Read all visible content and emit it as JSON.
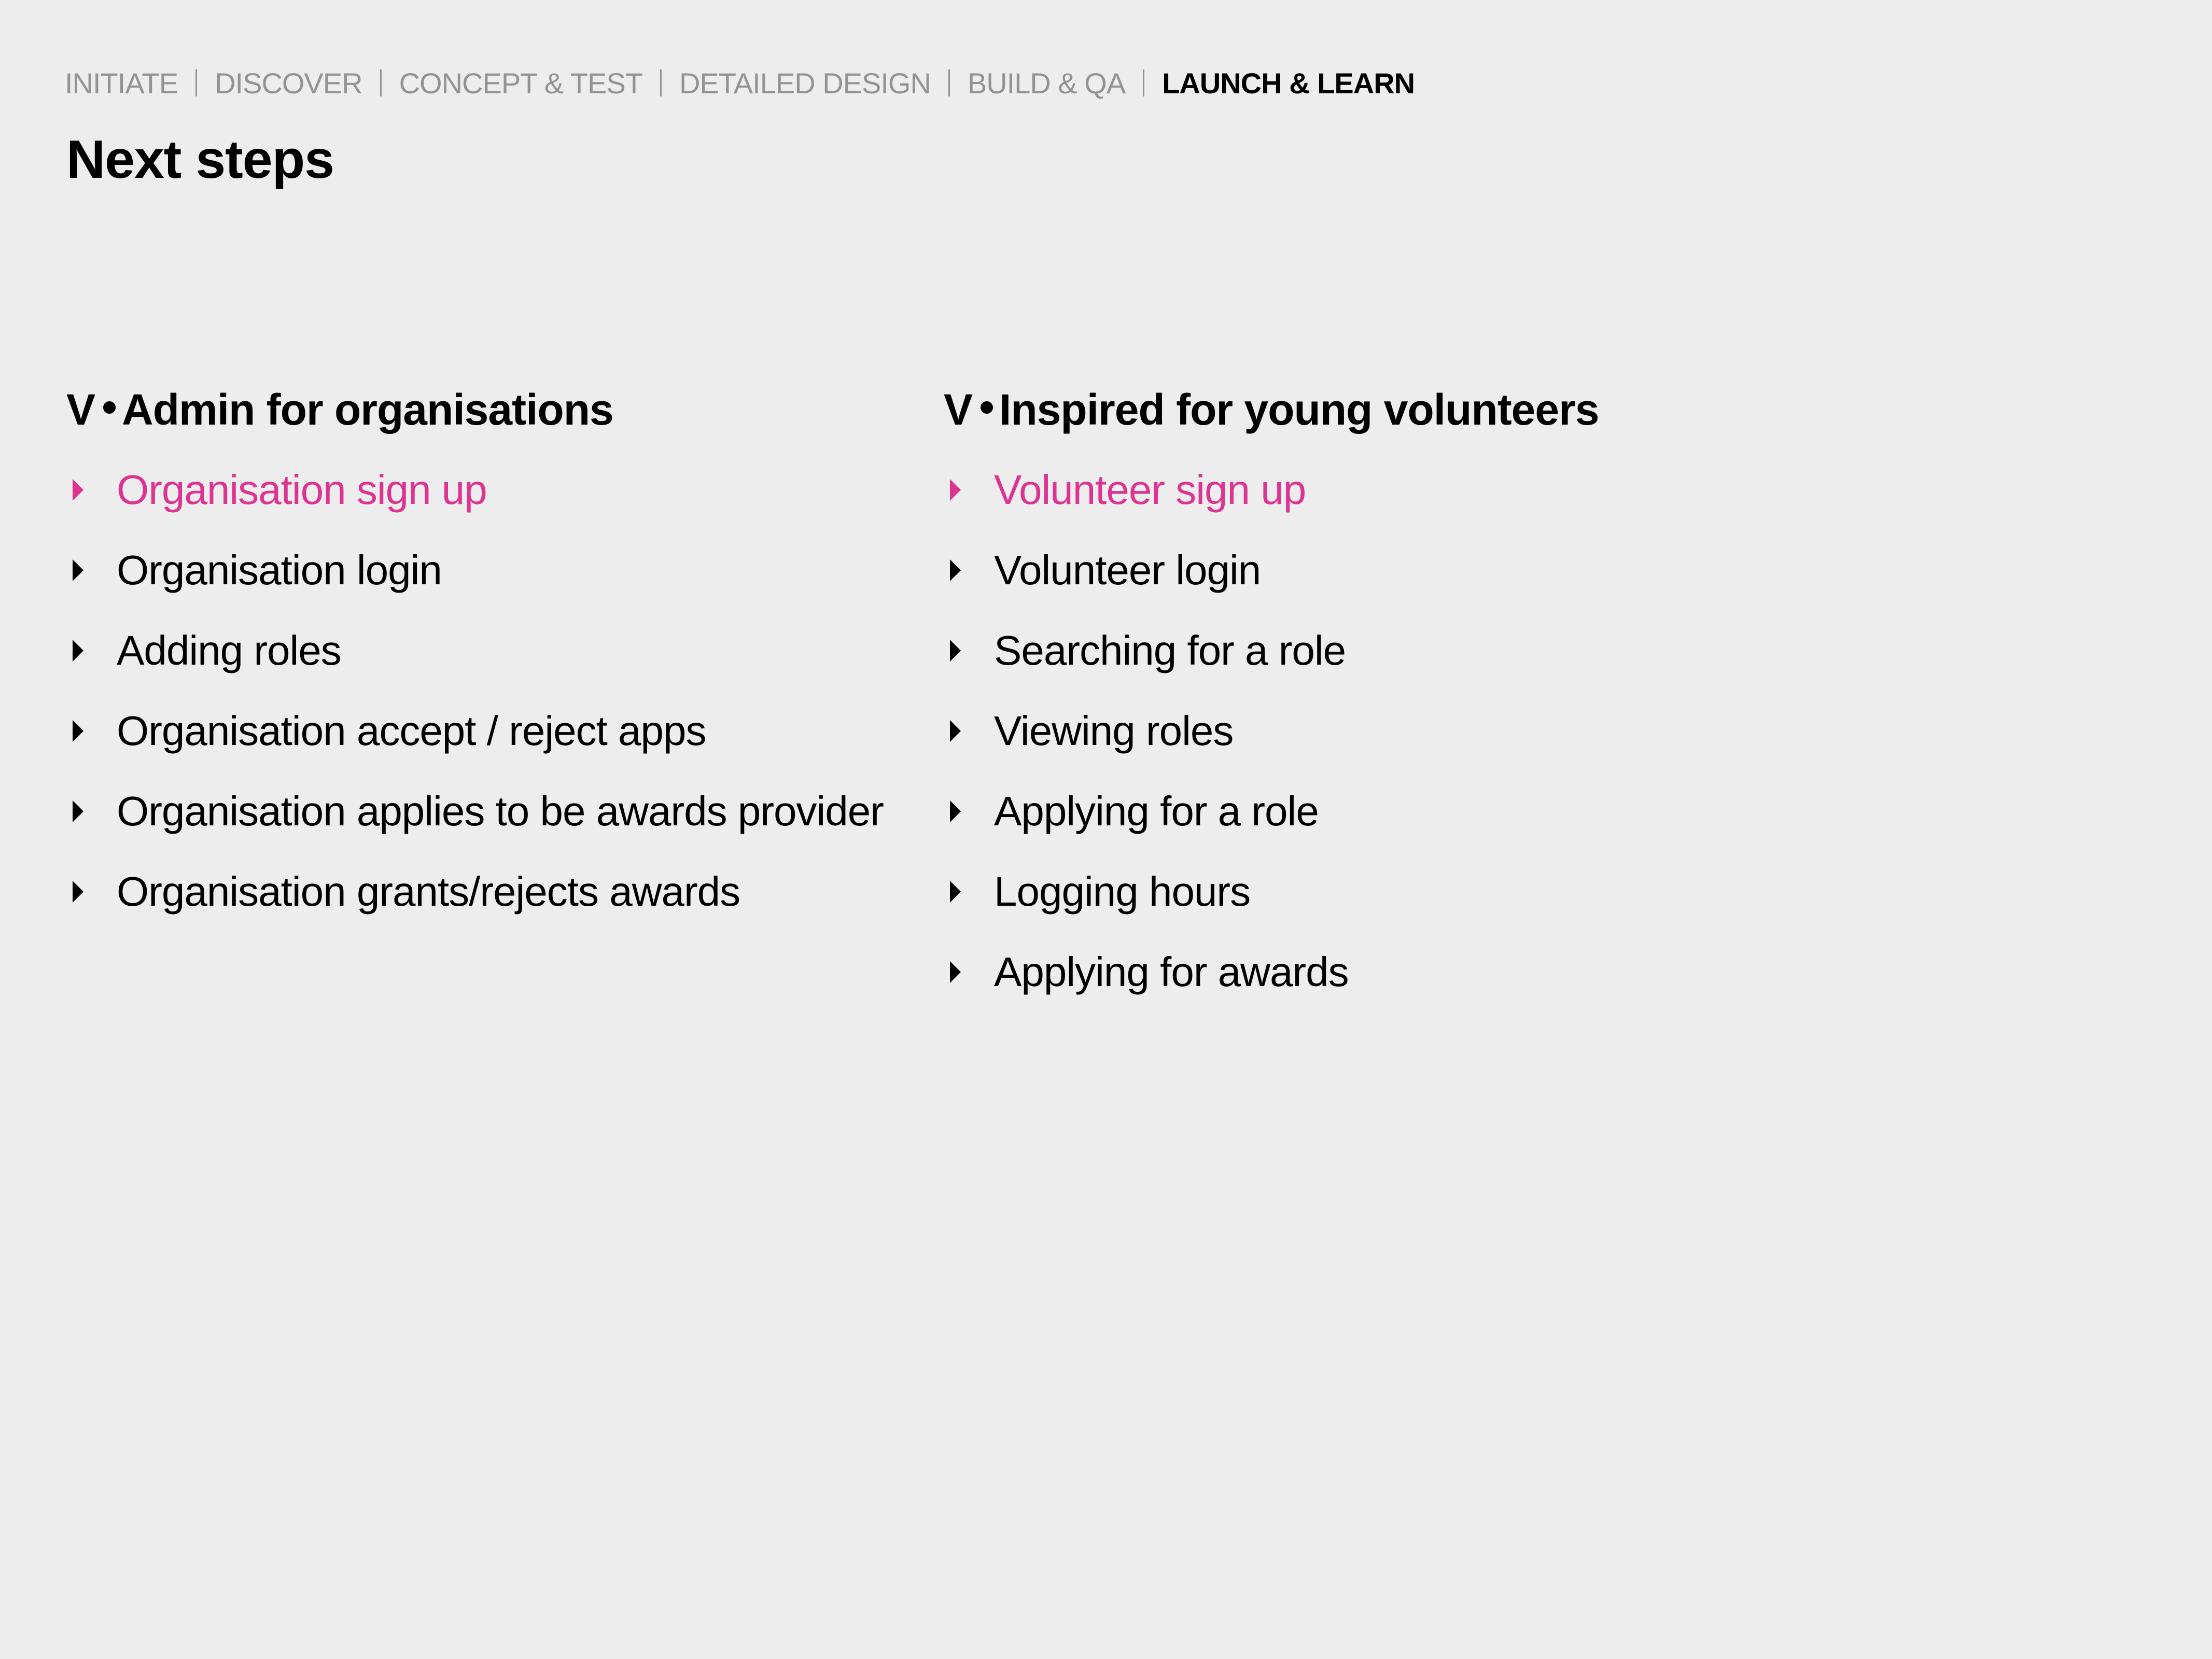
{
  "breadcrumb": {
    "items": [
      {
        "label": "INITIATE",
        "active": false
      },
      {
        "label": "DISCOVER",
        "active": false
      },
      {
        "label": "CONCEPT & TEST",
        "active": false
      },
      {
        "label": "DETAILED DESIGN",
        "active": false
      },
      {
        "label": "BUILD & QA",
        "active": false
      },
      {
        "label": "LAUNCH & LEARN",
        "active": true
      }
    ]
  },
  "page": {
    "title": "Next steps"
  },
  "colors": {
    "background": "#ededed",
    "inactive_crumb": "#939393",
    "active_text": "#000000",
    "highlight": "#dc3490"
  },
  "columns": [
    {
      "brand": "V",
      "heading": "Admin for organisations",
      "items": [
        {
          "label": "Organisation sign up",
          "highlighted": true
        },
        {
          "label": "Organisation login",
          "highlighted": false
        },
        {
          "label": "Adding roles",
          "highlighted": false
        },
        {
          "label": "Organisation accept / reject apps",
          "highlighted": false
        },
        {
          "label": "Organisation applies to be awards provider",
          "highlighted": false
        },
        {
          "label": "Organisation grants/rejects awards",
          "highlighted": false
        }
      ]
    },
    {
      "brand": "V",
      "heading": "Inspired for young volunteers",
      "items": [
        {
          "label": "Volunteer sign up",
          "highlighted": true
        },
        {
          "label": "Volunteer login",
          "highlighted": false
        },
        {
          "label": "Searching for a role",
          "highlighted": false
        },
        {
          "label": "Viewing roles",
          "highlighted": false
        },
        {
          "label": "Applying for a role",
          "highlighted": false
        },
        {
          "label": "Logging hours",
          "highlighted": false
        },
        {
          "label": "Applying for awards",
          "highlighted": false
        }
      ]
    }
  ]
}
